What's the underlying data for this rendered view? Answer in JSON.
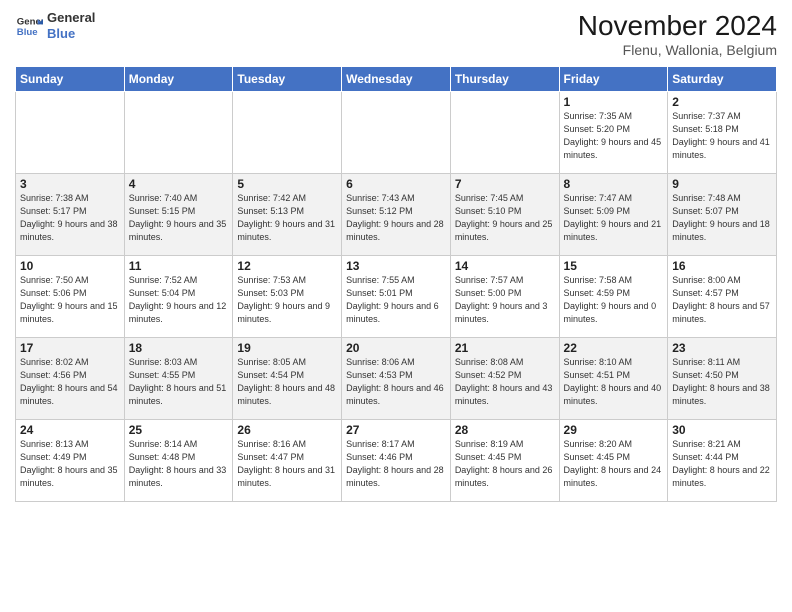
{
  "logo": {
    "line1": "General",
    "line2": "Blue"
  },
  "header": {
    "month": "November 2024",
    "location": "Flenu, Wallonia, Belgium"
  },
  "weekdays": [
    "Sunday",
    "Monday",
    "Tuesday",
    "Wednesday",
    "Thursday",
    "Friday",
    "Saturday"
  ],
  "weeks": [
    [
      {
        "day": "",
        "info": ""
      },
      {
        "day": "",
        "info": ""
      },
      {
        "day": "",
        "info": ""
      },
      {
        "day": "",
        "info": ""
      },
      {
        "day": "",
        "info": ""
      },
      {
        "day": "1",
        "info": "Sunrise: 7:35 AM\nSunset: 5:20 PM\nDaylight: 9 hours and 45 minutes."
      },
      {
        "day": "2",
        "info": "Sunrise: 7:37 AM\nSunset: 5:18 PM\nDaylight: 9 hours and 41 minutes."
      }
    ],
    [
      {
        "day": "3",
        "info": "Sunrise: 7:38 AM\nSunset: 5:17 PM\nDaylight: 9 hours and 38 minutes."
      },
      {
        "day": "4",
        "info": "Sunrise: 7:40 AM\nSunset: 5:15 PM\nDaylight: 9 hours and 35 minutes."
      },
      {
        "day": "5",
        "info": "Sunrise: 7:42 AM\nSunset: 5:13 PM\nDaylight: 9 hours and 31 minutes."
      },
      {
        "day": "6",
        "info": "Sunrise: 7:43 AM\nSunset: 5:12 PM\nDaylight: 9 hours and 28 minutes."
      },
      {
        "day": "7",
        "info": "Sunrise: 7:45 AM\nSunset: 5:10 PM\nDaylight: 9 hours and 25 minutes."
      },
      {
        "day": "8",
        "info": "Sunrise: 7:47 AM\nSunset: 5:09 PM\nDaylight: 9 hours and 21 minutes."
      },
      {
        "day": "9",
        "info": "Sunrise: 7:48 AM\nSunset: 5:07 PM\nDaylight: 9 hours and 18 minutes."
      }
    ],
    [
      {
        "day": "10",
        "info": "Sunrise: 7:50 AM\nSunset: 5:06 PM\nDaylight: 9 hours and 15 minutes."
      },
      {
        "day": "11",
        "info": "Sunrise: 7:52 AM\nSunset: 5:04 PM\nDaylight: 9 hours and 12 minutes."
      },
      {
        "day": "12",
        "info": "Sunrise: 7:53 AM\nSunset: 5:03 PM\nDaylight: 9 hours and 9 minutes."
      },
      {
        "day": "13",
        "info": "Sunrise: 7:55 AM\nSunset: 5:01 PM\nDaylight: 9 hours and 6 minutes."
      },
      {
        "day": "14",
        "info": "Sunrise: 7:57 AM\nSunset: 5:00 PM\nDaylight: 9 hours and 3 minutes."
      },
      {
        "day": "15",
        "info": "Sunrise: 7:58 AM\nSunset: 4:59 PM\nDaylight: 9 hours and 0 minutes."
      },
      {
        "day": "16",
        "info": "Sunrise: 8:00 AM\nSunset: 4:57 PM\nDaylight: 8 hours and 57 minutes."
      }
    ],
    [
      {
        "day": "17",
        "info": "Sunrise: 8:02 AM\nSunset: 4:56 PM\nDaylight: 8 hours and 54 minutes."
      },
      {
        "day": "18",
        "info": "Sunrise: 8:03 AM\nSunset: 4:55 PM\nDaylight: 8 hours and 51 minutes."
      },
      {
        "day": "19",
        "info": "Sunrise: 8:05 AM\nSunset: 4:54 PM\nDaylight: 8 hours and 48 minutes."
      },
      {
        "day": "20",
        "info": "Sunrise: 8:06 AM\nSunset: 4:53 PM\nDaylight: 8 hours and 46 minutes."
      },
      {
        "day": "21",
        "info": "Sunrise: 8:08 AM\nSunset: 4:52 PM\nDaylight: 8 hours and 43 minutes."
      },
      {
        "day": "22",
        "info": "Sunrise: 8:10 AM\nSunset: 4:51 PM\nDaylight: 8 hours and 40 minutes."
      },
      {
        "day": "23",
        "info": "Sunrise: 8:11 AM\nSunset: 4:50 PM\nDaylight: 8 hours and 38 minutes."
      }
    ],
    [
      {
        "day": "24",
        "info": "Sunrise: 8:13 AM\nSunset: 4:49 PM\nDaylight: 8 hours and 35 minutes."
      },
      {
        "day": "25",
        "info": "Sunrise: 8:14 AM\nSunset: 4:48 PM\nDaylight: 8 hours and 33 minutes."
      },
      {
        "day": "26",
        "info": "Sunrise: 8:16 AM\nSunset: 4:47 PM\nDaylight: 8 hours and 31 minutes."
      },
      {
        "day": "27",
        "info": "Sunrise: 8:17 AM\nSunset: 4:46 PM\nDaylight: 8 hours and 28 minutes."
      },
      {
        "day": "28",
        "info": "Sunrise: 8:19 AM\nSunset: 4:45 PM\nDaylight: 8 hours and 26 minutes."
      },
      {
        "day": "29",
        "info": "Sunrise: 8:20 AM\nSunset: 4:45 PM\nDaylight: 8 hours and 24 minutes."
      },
      {
        "day": "30",
        "info": "Sunrise: 8:21 AM\nSunset: 4:44 PM\nDaylight: 8 hours and 22 minutes."
      }
    ]
  ]
}
